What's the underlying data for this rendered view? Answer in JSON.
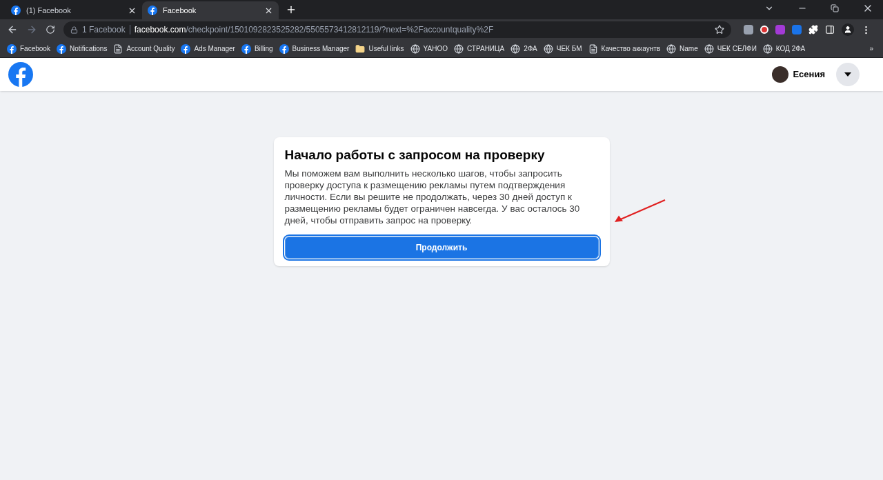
{
  "tabs": [
    {
      "title": "(1) Facebook",
      "selected": false
    },
    {
      "title": "Facebook",
      "selected": true
    }
  ],
  "address_bar": {
    "site_label": "1 Facebook",
    "domain": "facebook.com",
    "path": "/checkpoint/1501092823525282/5505573412812119/?next=%2Faccountquality%2F"
  },
  "bookmarks": [
    {
      "label": "Facebook",
      "kind": "fb"
    },
    {
      "label": "Notifications",
      "kind": "fb"
    },
    {
      "label": "Account Quality",
      "kind": "doc"
    },
    {
      "label": "Ads Manager",
      "kind": "fb"
    },
    {
      "label": "Billing",
      "kind": "fb"
    },
    {
      "label": "Business Manager",
      "kind": "fb"
    },
    {
      "label": "Useful links",
      "kind": "folder"
    },
    {
      "label": "YAHOO",
      "kind": "globe"
    },
    {
      "label": "СТРАНИЦА",
      "kind": "globe"
    },
    {
      "label": "2ФА",
      "kind": "globe"
    },
    {
      "label": "ЧЕК БМ",
      "kind": "globe"
    },
    {
      "label": "Качество аккаунтв",
      "kind": "doc"
    },
    {
      "label": "Name",
      "kind": "globe"
    },
    {
      "label": "ЧЕК СЕЛФИ",
      "kind": "globe"
    },
    {
      "label": "КОД 2ФА",
      "kind": "globe"
    }
  ],
  "bookmarks_more": "»",
  "header": {
    "user_name": "Есения"
  },
  "card": {
    "title": "Начало работы с запросом на проверку",
    "body": "Мы поможем вам выполнить несколько шагов, чтобы запросить проверку доступа к размещению рекламы путем подтверждения личности. Если вы решите не продолжать, через 30 дней доступ к размещению рекламы будет ограничен навсегда. У вас осталось 30 дней, чтобы отправить запрос на проверку.",
    "button": "Продолжить"
  }
}
